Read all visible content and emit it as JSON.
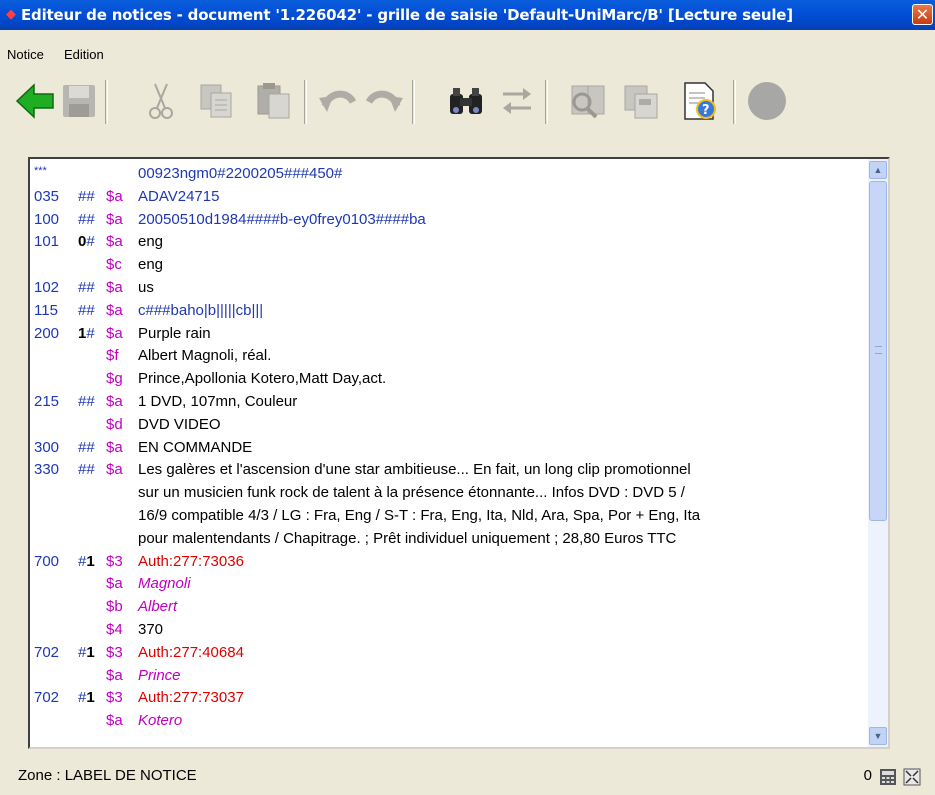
{
  "window": {
    "title": "Editeur de notices - document '1.226042' - grille de saisie 'Default-UniMarc/B' [Lecture seule]",
    "close_label": "✕"
  },
  "menu": [
    "Notice",
    "Edition"
  ],
  "toolbar": {
    "buttons": [
      "back-icon",
      "save-icon",
      "cut-icon",
      "copy-icon",
      "paste-icon",
      "undo-icon",
      "redo-icon",
      "find-icon",
      "replace-icon",
      "browse-icon",
      "copy-record-icon",
      "help-document-icon",
      "record-status-icon"
    ]
  },
  "colors": {
    "tag": "#1e38b4",
    "subfield": "#c000c0",
    "authority": "#e00000"
  },
  "record": {
    "leader": {
      "marker": "***",
      "value": "00923ngm0#2200205###450#"
    },
    "lines": [
      {
        "tag": "035",
        "ind1": "#",
        "ind2": "#",
        "sub": "$a",
        "val": "ADAV24715"
      },
      {
        "tag": "100",
        "ind1": "#",
        "ind2": "#",
        "sub": "$a",
        "val": "20050510d1984####b-ey0frey0103####ba"
      },
      {
        "tag": "101",
        "ind1": "0",
        "ind2": "#",
        "sub": "$a",
        "val": "eng"
      },
      {
        "sub": "$c",
        "val": "eng"
      },
      {
        "tag": "102",
        "ind1": "#",
        "ind2": "#",
        "sub": "$a",
        "val": "us"
      },
      {
        "tag": "115",
        "ind1": "#",
        "ind2": "#",
        "sub": "$a",
        "val": "c###baho|b|||||cb|||"
      },
      {
        "tag": "200",
        "ind1": "1",
        "ind2": "#",
        "sub": "$a",
        "val": "Purple rain"
      },
      {
        "sub": "$f",
        "val": "Albert Magnoli, réal."
      },
      {
        "sub": "$g",
        "val": " Prince,Apollonia Kotero,Matt Day,act."
      },
      {
        "tag": "215",
        "ind1": "#",
        "ind2": "#",
        "sub": "$a",
        "val": "1 DVD, 107mn, Couleur"
      },
      {
        "sub": "$d",
        "val": "DVD VIDEO"
      },
      {
        "tag": "300",
        "ind1": "#",
        "ind2": "#",
        "sub": "$a",
        "val": "EN COMMANDE"
      },
      {
        "tag": "330",
        "ind1": "#",
        "ind2": "#",
        "sub": "$a",
        "val": " Les galères et l'ascension d'une star ambitieuse... En fait, un long clip promotionnel"
      },
      {
        "val": "sur un musicien funk rock de talent à la présence étonnante... Infos DVD : DVD 5 /"
      },
      {
        "val": "16/9 compatible 4/3 / LG : Fra, Eng / S-T : Fra, Eng, Ita, Nld, Ara, Spa, Por + Eng, Ita"
      },
      {
        "val": "pour malentendants / Chapitrage. ; Prêt individuel uniquement ; 28,80 Euros TTC"
      },
      {
        "tag": "700",
        "ind1": "#",
        "ind2": "1",
        "sub": "$3",
        "val": "Auth:277:73036"
      },
      {
        "sub": "$a",
        "val": "Magnoli"
      },
      {
        "sub": "$b",
        "val": "Albert"
      },
      {
        "sub": "$4",
        "val": "370"
      },
      {
        "tag": "702",
        "ind1": "#",
        "ind2": "1",
        "sub": "$3",
        "val": "Auth:277:40684"
      },
      {
        "sub": "$a",
        "val": "Prince"
      },
      {
        "tag": "702",
        "ind1": "#",
        "ind2": "1",
        "sub": "$3",
        "val": "Auth:277:73037"
      },
      {
        "sub": "$a",
        "val": "Kotero"
      }
    ]
  },
  "status": {
    "zone": "Zone : LABEL DE NOTICE",
    "count": "0"
  }
}
